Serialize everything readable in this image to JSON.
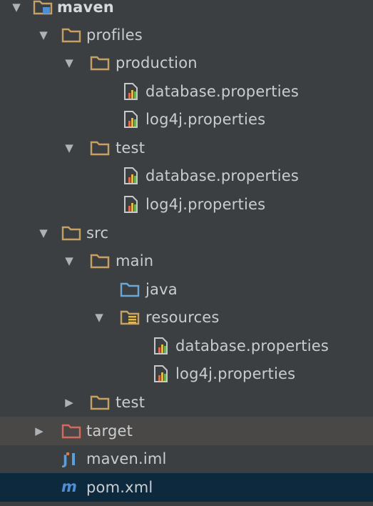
{
  "colors": {
    "background": "#3c3f41",
    "folder": "#c7a063",
    "source_folder": "#6ba8d6",
    "excluded_folder": "#d46a5e",
    "selected_row": "#0d293e",
    "highlight_row": "#4a4846"
  },
  "tree": {
    "root": {
      "label": "maven",
      "icon": "module-folder-icon",
      "expanded": true
    },
    "profiles": {
      "label": "profiles",
      "icon": "folder-icon",
      "expanded": true
    },
    "production": {
      "label": "production",
      "icon": "folder-icon",
      "expanded": true
    },
    "production_db": {
      "label": "database.properties",
      "icon": "properties-file-icon"
    },
    "production_log": {
      "label": "log4j.properties",
      "icon": "properties-file-icon"
    },
    "profile_test": {
      "label": "test",
      "icon": "folder-icon",
      "expanded": true
    },
    "test_db": {
      "label": "database.properties",
      "icon": "properties-file-icon"
    },
    "test_log": {
      "label": "log4j.properties",
      "icon": "properties-file-icon"
    },
    "src": {
      "label": "src",
      "icon": "folder-icon",
      "expanded": true
    },
    "main": {
      "label": "main",
      "icon": "folder-icon",
      "expanded": true
    },
    "java": {
      "label": "java",
      "icon": "source-folder-icon"
    },
    "resources": {
      "label": "resources",
      "icon": "resources-folder-icon",
      "expanded": true
    },
    "resources_db": {
      "label": "database.properties",
      "icon": "properties-file-icon"
    },
    "resources_log": {
      "label": "log4j.properties",
      "icon": "properties-file-icon"
    },
    "src_test": {
      "label": "test",
      "icon": "folder-icon",
      "expanded": false
    },
    "target": {
      "label": "target",
      "icon": "excluded-folder-icon",
      "expanded": false
    },
    "iml": {
      "label": "maven.iml",
      "icon": "iml-file-icon"
    },
    "pom": {
      "label": "pom.xml",
      "icon": "maven-pom-icon"
    }
  }
}
